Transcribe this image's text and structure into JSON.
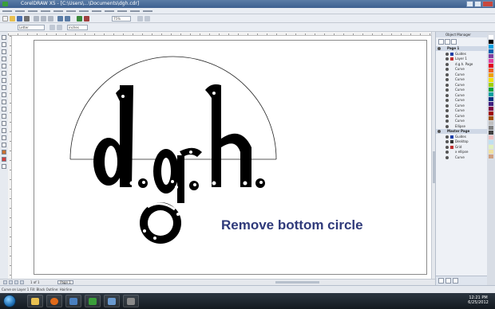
{
  "window": {
    "title": "CorelDRAW X5 - [C:\\Users\\...\\Documents\\dgh.cdr]"
  },
  "property_bar": {
    "zoom": "75%",
    "page_size": "Letter",
    "units": "inches"
  },
  "canvas": {
    "instruction": "Remove bottom circle",
    "text_color": "#2f3a7a"
  },
  "page_nav": {
    "counter": "1 of 1",
    "tab": "Page 1"
  },
  "docker": {
    "title": "Object Manager",
    "layers": [
      {
        "label": "Page 1",
        "header": true,
        "swatch": ""
      },
      {
        "label": "Guides",
        "header": false,
        "swatch": "#1e3fa8"
      },
      {
        "label": "Layer 1",
        "header": false,
        "swatch": "#c03030"
      },
      {
        "label": "d.g.h. Page",
        "header": false,
        "swatch": ""
      },
      {
        "label": "Curve",
        "header": false,
        "swatch": ""
      },
      {
        "label": "Curve",
        "header": false,
        "swatch": ""
      },
      {
        "label": "Curve",
        "header": false,
        "swatch": ""
      },
      {
        "label": "Curve",
        "header": false,
        "swatch": ""
      },
      {
        "label": "Curve",
        "header": false,
        "swatch": ""
      },
      {
        "label": "Curve",
        "header": false,
        "swatch": ""
      },
      {
        "label": "Curve",
        "header": false,
        "swatch": ""
      },
      {
        "label": "Curve",
        "header": false,
        "swatch": ""
      },
      {
        "label": "Curve",
        "header": false,
        "swatch": ""
      },
      {
        "label": "Curve",
        "header": false,
        "swatch": ""
      },
      {
        "label": "Curve",
        "header": false,
        "swatch": ""
      },
      {
        "label": "Ellipse",
        "header": false,
        "swatch": ""
      },
      {
        "label": "Master Page",
        "header": true,
        "swatch": ""
      },
      {
        "label": "Guides",
        "header": false,
        "swatch": "#1e3fa8"
      },
      {
        "label": "Desktop",
        "header": false,
        "swatch": "#333333"
      },
      {
        "label": "Grid",
        "header": false,
        "swatch": "#c03030"
      },
      {
        "label": "x ellipse",
        "header": false,
        "swatch": ""
      },
      {
        "label": "Curve",
        "header": false,
        "swatch": ""
      }
    ]
  },
  "statusbar": {
    "text": "Curve on Layer 1    Fill: Black    Outline: Hairline"
  },
  "palette": {
    "colors": [
      "#ffffff",
      "#000000",
      "#00a0e0",
      "#0060b0",
      "#8040a0",
      "#e040a0",
      "#e00020",
      "#f06020",
      "#f0a000",
      "#f0e000",
      "#a0d000",
      "#00a040",
      "#00a0a0",
      "#003080",
      "#402080",
      "#800040",
      "#a00000",
      "#a05000",
      "#c0c0c0",
      "#808080",
      "#404040",
      "#f0c0c0",
      "#c0e0f0",
      "#e0f0c0",
      "#f0e0a0",
      "#d0a080"
    ]
  },
  "taskbar": {
    "time": "12:21 PM",
    "date": "6/25/2012"
  }
}
